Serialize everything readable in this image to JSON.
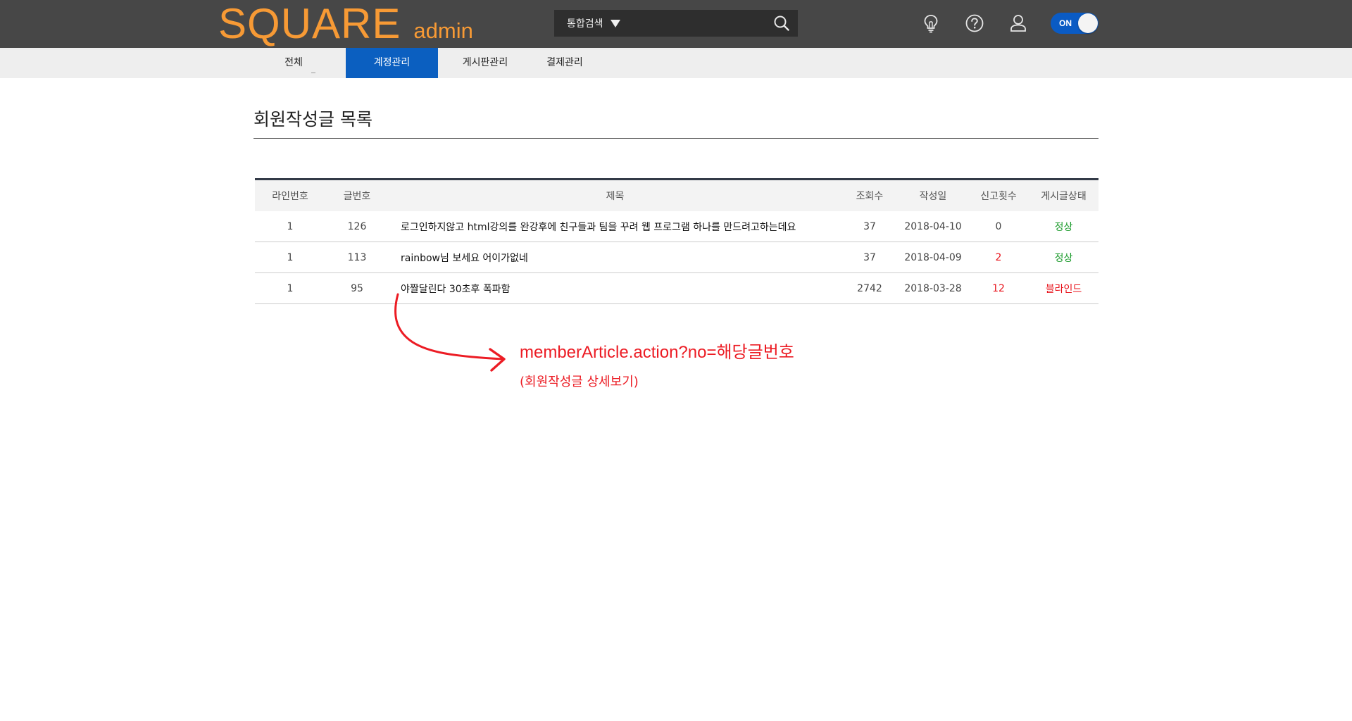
{
  "header": {
    "logo_main": "SQUARE",
    "logo_sub": "admin",
    "search": {
      "scope_label": "통합검색",
      "value": ""
    },
    "icons": [
      "lightbulb-icon",
      "help-icon",
      "user-icon"
    ],
    "toggle": {
      "label": "ON",
      "state": true
    }
  },
  "nav": {
    "items": [
      {
        "label": "전체",
        "active": false
      },
      {
        "label": "계정관리",
        "active": true
      },
      {
        "label": "게시판관리",
        "active": false
      },
      {
        "label": "결제관리",
        "active": false
      }
    ]
  },
  "page": {
    "title": "회원작성글 목록"
  },
  "table": {
    "columns": [
      "라인번호",
      "글번호",
      "제목",
      "조회수",
      "작성일",
      "신고횟수",
      "게시글상태"
    ],
    "rows": [
      {
        "line": "1",
        "no": "126",
        "title": "로그인하지않고 html강의를 완강후에 친구들과 팀을 꾸려 웹 프로그램 하나를 만드려고하는데요",
        "views": "37",
        "date": "2018-04-10",
        "reports": "0",
        "status": "정상"
      },
      {
        "line": "1",
        "no": "113",
        "title": "rainbow님 보세요 어이가없네",
        "views": "37",
        "date": "2018-04-09",
        "reports": "2",
        "status": "정상"
      },
      {
        "line": "1",
        "no": "95",
        "title": "야짤달린다 30초후 폭파함",
        "views": "2742",
        "date": "2018-03-28",
        "reports": "12",
        "status": "블라인드"
      }
    ]
  },
  "annotation": {
    "url": "memberArticle.action?no=해당글번호",
    "desc": "(회원작성글 상세보기)"
  },
  "colors": {
    "header_bg": "#474747",
    "logo": "#f79a35",
    "nav_active": "#0b5fc0",
    "status_ok": "#1a9a2a",
    "status_bad": "#e8131b",
    "annotation": "#ec1c24"
  }
}
